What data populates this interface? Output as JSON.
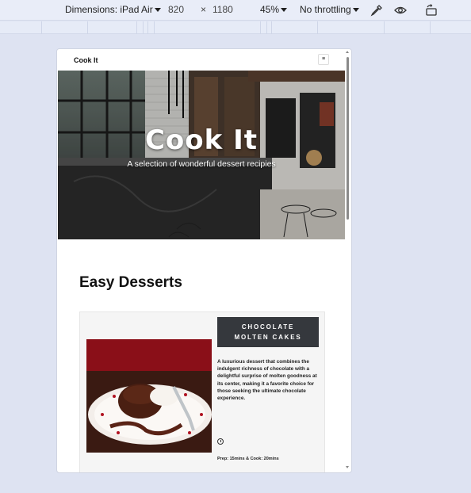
{
  "devtools": {
    "dimensions_label": "Dimensions: iPad Air",
    "width": "820",
    "times": "×",
    "height": "1180",
    "zoom": "45%",
    "throttling": "No throttling"
  },
  "site": {
    "brand": "Cook It",
    "menu_icon": "≡",
    "hero": {
      "title": "Cook It",
      "subtitle": "A selection of wonderful dessert recipies"
    },
    "section_title": "Easy Desserts",
    "card": {
      "title_line1": "CHOCOLATE",
      "title_line2": "MOLTEN CAKES",
      "description": "A luxurious dessert that combines the indulgent richness of chocolate with a delightful surprise of molten goodness at its center, making it a favorite choice for those seeking the ultimate chocolate experience.",
      "time": "Prep: 15mins & Cook: 20mins"
    }
  },
  "icons": [
    "eyedropper-icon",
    "eye-icon",
    "rotate-device-icon",
    "clock-icon",
    "menu-icon"
  ]
}
